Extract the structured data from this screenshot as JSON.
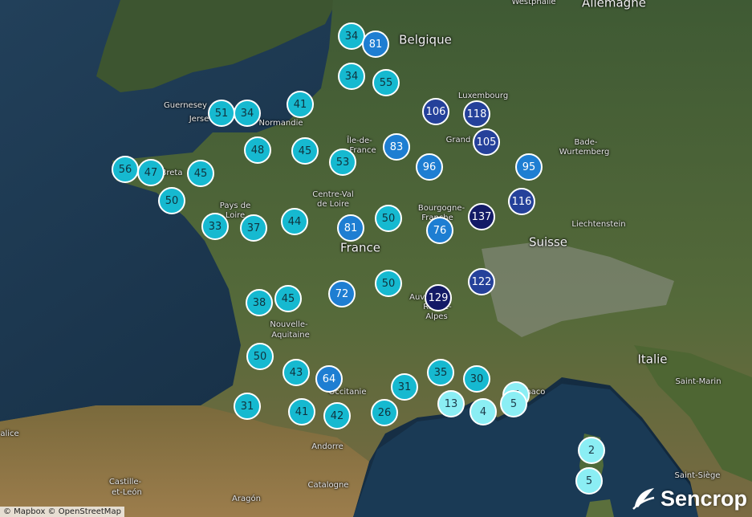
{
  "map": {
    "labels": [
      {
        "key": "westphalie",
        "text": "Westphalie",
        "kind": "small"
      },
      {
        "key": "allemagne",
        "text": "Allemagne",
        "kind": "country"
      },
      {
        "key": "belgique",
        "text": "Belgique",
        "kind": "country"
      },
      {
        "key": "luxembourg",
        "text": "Luxembourg",
        "kind": "small"
      },
      {
        "key": "guernesey",
        "text": "Guernesey",
        "kind": "small"
      },
      {
        "key": "jersey",
        "text": "Jerse",
        "kind": "small"
      },
      {
        "key": "normandie",
        "text": "Normandie",
        "kind": "small"
      },
      {
        "key": "ile-de-france-1",
        "text": "Île-de-",
        "kind": "small"
      },
      {
        "key": "ile-de-france-2",
        "text": "France",
        "kind": "small"
      },
      {
        "key": "grand-est",
        "text": "Grand",
        "kind": "small"
      },
      {
        "key": "bade-1",
        "text": "Bade-",
        "kind": "small"
      },
      {
        "key": "bade-2",
        "text": "Wurtemberg",
        "kind": "small"
      },
      {
        "key": "bretagne",
        "text": "Breta",
        "kind": "small"
      },
      {
        "key": "pays-de-loire-1",
        "text": "Pays de",
        "kind": "small"
      },
      {
        "key": "pays-de-loire-2",
        "text": "Loire",
        "kind": "small"
      },
      {
        "key": "centre-1",
        "text": "Centre-Val",
        "kind": "small"
      },
      {
        "key": "centre-2",
        "text": "de Loire",
        "kind": "small"
      },
      {
        "key": "bourgogne-1",
        "text": "Bourgogne-",
        "kind": "small"
      },
      {
        "key": "bourgogne-2",
        "text": "Franche",
        "kind": "small"
      },
      {
        "key": "liechtenstein",
        "text": "Liechtenstein",
        "kind": "small"
      },
      {
        "key": "france",
        "text": "France",
        "kind": "country"
      },
      {
        "key": "suisse",
        "text": "Suisse",
        "kind": "country"
      },
      {
        "key": "auvergne-1",
        "text": "Auvergne-",
        "kind": "small"
      },
      {
        "key": "auvergne-2",
        "text": "Rhône-",
        "kind": "small"
      },
      {
        "key": "auvergne-3",
        "text": "Alpes",
        "kind": "small"
      },
      {
        "key": "nouvelle-1",
        "text": "Nouvelle-",
        "kind": "small"
      },
      {
        "key": "nouvelle-2",
        "text": "Aquitaine",
        "kind": "small"
      },
      {
        "key": "italie",
        "text": "Italie",
        "kind": "country"
      },
      {
        "key": "saint-marin",
        "text": "Saint-Marin",
        "kind": "small"
      },
      {
        "key": "occitanie",
        "text": "Occitanie",
        "kind": "small"
      },
      {
        "key": "monaco",
        "text": "Monaco",
        "kind": "small"
      },
      {
        "key": "galice",
        "text": "alice",
        "kind": "small"
      },
      {
        "key": "andorre",
        "text": "Andorre",
        "kind": "small"
      },
      {
        "key": "saint-siege",
        "text": "Saint-Siège",
        "kind": "small"
      },
      {
        "key": "castille-1",
        "text": "Castille-",
        "kind": "small"
      },
      {
        "key": "castille-2",
        "text": "et-León",
        "kind": "small"
      },
      {
        "key": "aragon",
        "text": "Aragón",
        "kind": "small"
      },
      {
        "key": "catalogne",
        "text": "Catalogne",
        "kind": "small"
      }
    ],
    "clusters": [
      {
        "id": "lille-w",
        "count": "34",
        "tier": 2
      },
      {
        "id": "lille-e",
        "count": "81",
        "tier": 3
      },
      {
        "id": "amiens",
        "count": "34",
        "tier": 2
      },
      {
        "id": "reims",
        "count": "55",
        "tier": 2
      },
      {
        "id": "normandie-w",
        "count": "51",
        "tier": 2
      },
      {
        "id": "normandie-e",
        "count": "34",
        "tier": 2
      },
      {
        "id": "rouen",
        "count": "41",
        "tier": 2
      },
      {
        "id": "lorraine-n",
        "count": "106",
        "tier": 4
      },
      {
        "id": "luxembourg",
        "count": "118",
        "tier": 4
      },
      {
        "id": "normandie-s",
        "count": "48",
        "tier": 2
      },
      {
        "id": "chartres",
        "count": "45",
        "tier": 2
      },
      {
        "id": "paris-s",
        "count": "53",
        "tier": 2
      },
      {
        "id": "champagne",
        "count": "83",
        "tier": 3
      },
      {
        "id": "nancy",
        "count": "96",
        "tier": 3
      },
      {
        "id": "strasbourg",
        "count": "105",
        "tier": 4
      },
      {
        "id": "bade",
        "count": "95",
        "tier": 3
      },
      {
        "id": "brest",
        "count": "56",
        "tier": 2
      },
      {
        "id": "bretagne-c",
        "count": "47",
        "tier": 2
      },
      {
        "id": "rennes",
        "count": "45",
        "tier": 2
      },
      {
        "id": "vannes",
        "count": "50",
        "tier": 2
      },
      {
        "id": "alsace-s",
        "count": "116",
        "tier": 4
      },
      {
        "id": "nantes",
        "count": "33",
        "tier": 2
      },
      {
        "id": "vendee",
        "count": "37",
        "tier": 2
      },
      {
        "id": "tours",
        "count": "44",
        "tier": 2
      },
      {
        "id": "orleans",
        "count": "81",
        "tier": 3
      },
      {
        "id": "dijon-w",
        "count": "50",
        "tier": 2
      },
      {
        "id": "besancon",
        "count": "137",
        "tier": 5
      },
      {
        "id": "bourgogne-s",
        "count": "76",
        "tier": 3
      },
      {
        "id": "geneve",
        "count": "122",
        "tier": 4
      },
      {
        "id": "charente",
        "count": "38",
        "tier": 2
      },
      {
        "id": "limousin",
        "count": "45",
        "tier": 2
      },
      {
        "id": "auvergne",
        "count": "72",
        "tier": 3
      },
      {
        "id": "loire",
        "count": "50",
        "tier": 2
      },
      {
        "id": "lyon",
        "count": "129",
        "tier": 5
      },
      {
        "id": "bordeaux",
        "count": "50",
        "tier": 2
      },
      {
        "id": "agen",
        "count": "43",
        "tier": 2
      },
      {
        "id": "toulouse-n",
        "count": "64",
        "tier": 3
      },
      {
        "id": "drome",
        "count": "35",
        "tier": 2
      },
      {
        "id": "vaucluse",
        "count": "30",
        "tier": 2
      },
      {
        "id": "nice",
        "count": "7",
        "tier": 1
      },
      {
        "id": "landes",
        "count": "31",
        "tier": 2
      },
      {
        "id": "gard",
        "count": "31",
        "tier": 2
      },
      {
        "id": "var-w",
        "count": "13",
        "tier": 1
      },
      {
        "id": "nice-s",
        "count": "5",
        "tier": 1
      },
      {
        "id": "toulon",
        "count": "4",
        "tier": 1
      },
      {
        "id": "toulouse",
        "count": "41",
        "tier": 2
      },
      {
        "id": "ariege",
        "count": "42",
        "tier": 2
      },
      {
        "id": "herault",
        "count": "26",
        "tier": 2
      },
      {
        "id": "corse-n",
        "count": "2",
        "tier": 1
      },
      {
        "id": "corse-s",
        "count": "5",
        "tier": 1
      }
    ]
  },
  "attribution": "© Mapbox © OpenStreetMap",
  "brand": {
    "name": "Sencrop",
    "icon": "sencrop-leaf-icon"
  },
  "colors": {
    "tier1": "#8beef4",
    "tier2": "#16b9d0",
    "tier3": "#1e7ed2",
    "tier4": "#25419a",
    "tier5": "#131a66",
    "sea": "#1f3a4f"
  }
}
